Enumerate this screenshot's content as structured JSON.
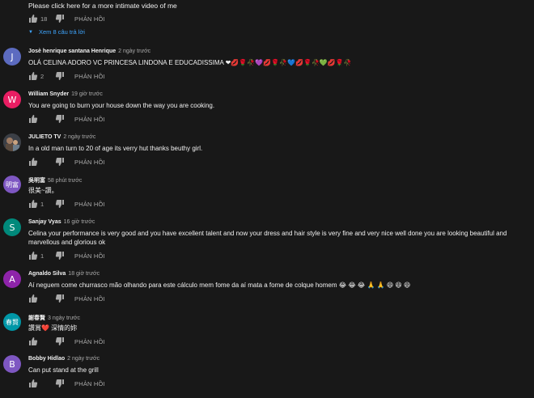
{
  "top": {
    "text": "Please click here for a more intimate video of me",
    "likes": "18",
    "reply_label": "PHẢN HỒI",
    "view_replies": "Xem 8 câu trả lời"
  },
  "comments": [
    {
      "author": "Josè henrique santana Henrique",
      "time": "2 ngày trước",
      "text": "OLÁ CELINA ADORO VC PRINCESA LINDONA E EDUCADISSIMA ❤💋🌹🥀💜💋🌹🥀💙💋🌹🥀💚💋🌹🥀",
      "likes": "2",
      "reply": "PHẢN HỒI",
      "avatar_letter": "J",
      "avatar_color": "#5c6bc0"
    },
    {
      "author": "William Snyder",
      "time": "19 giờ trước",
      "text": "You are going to burn your house down the way you are cooking.",
      "likes": "",
      "reply": "PHẢN HỒI",
      "avatar_letter": "W",
      "avatar_color": "#e91e63"
    },
    {
      "author": "JULIETO TV",
      "time": "2 ngày trước",
      "text": "In a  old man turn to 20 of age its verry hut thanks  beuthy girl.",
      "likes": "",
      "reply": "PHẢN HỒI",
      "avatar_letter": "",
      "avatar_color": "#4a4a4a"
    },
    {
      "author": "吳明富",
      "time": "58 phút trước",
      "text": "很美~讚。",
      "likes": "1",
      "reply": "PHẢN HỒI",
      "avatar_letter": "明富",
      "avatar_color": "#7e57c2"
    },
    {
      "author": "Sanjay Vyas",
      "time": "16 giờ trước",
      "text": "Celina your performance is very good and you have excellent talent and now your dress and hair style is very fine and very nice well done you are looking beautiful and marvellous and glorious ok",
      "likes": "1",
      "reply": "PHẢN HỒI",
      "avatar_letter": "S",
      "avatar_color": "#00897b"
    },
    {
      "author": "Agnaldo Silva",
      "time": "18 giờ trước",
      "text": "Aí neguem come churrasco mão olhando para este cálculo mem fome da aí mata a fome de colque homem 😂 😂 😂 🙏 🙏 😆 😆 😆",
      "likes": "",
      "reply": "PHẢN HỒI",
      "avatar_letter": "A",
      "avatar_color": "#8e24aa"
    },
    {
      "author": "謝春賢",
      "time": "3 ngày trước",
      "text": "讚賞❤️ 深情的妳",
      "likes": "",
      "reply": "PHẢN HỒI",
      "avatar_letter": "春賢",
      "avatar_color": "#0097a7"
    },
    {
      "author": "Bobby Hidlao",
      "time": "2 ngày trước",
      "text": "Can put stand at the grill",
      "likes": "",
      "reply": "PHẢN HỒI",
      "avatar_letter": "B",
      "avatar_color": "#7e57c2"
    }
  ]
}
